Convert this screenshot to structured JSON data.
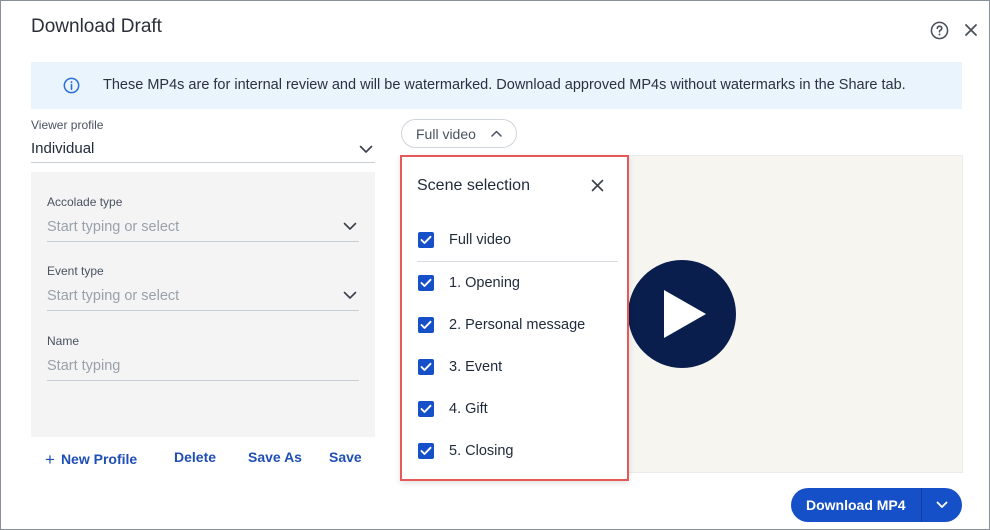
{
  "dialog": {
    "title": "Download Draft"
  },
  "banner": {
    "text": "These MP4s are for internal review and will be watermarked. Download approved MP4s without watermarks in the Share tab."
  },
  "viewer_profile": {
    "label": "Viewer profile",
    "value": "Individual"
  },
  "fields": {
    "accolade": {
      "label": "Accolade type",
      "placeholder": "Start typing or select"
    },
    "event": {
      "label": "Event type",
      "placeholder": "Start typing or select"
    },
    "name": {
      "label": "Name",
      "placeholder": "Start typing"
    }
  },
  "actions": {
    "new_profile": "New Profile",
    "delete": "Delete",
    "save_as": "Save As",
    "save": "Save"
  },
  "scene_chip": {
    "label": "Full video"
  },
  "scene_panel": {
    "title": "Scene selection",
    "full_video": {
      "label": "Full video",
      "checked": true
    },
    "scenes": [
      {
        "label": "1. Opening",
        "checked": true
      },
      {
        "label": "2. Personal message",
        "checked": true
      },
      {
        "label": "3. Event",
        "checked": true
      },
      {
        "label": "4. Gift",
        "checked": true
      },
      {
        "label": "5. Closing",
        "checked": true
      }
    ]
  },
  "download": {
    "label": "Download MP4"
  },
  "colors": {
    "accent": "#1650c8",
    "highlight_border": "#e45a5a",
    "banner_bg": "#eaf4fd",
    "play_bg": "#0a1e4d"
  }
}
